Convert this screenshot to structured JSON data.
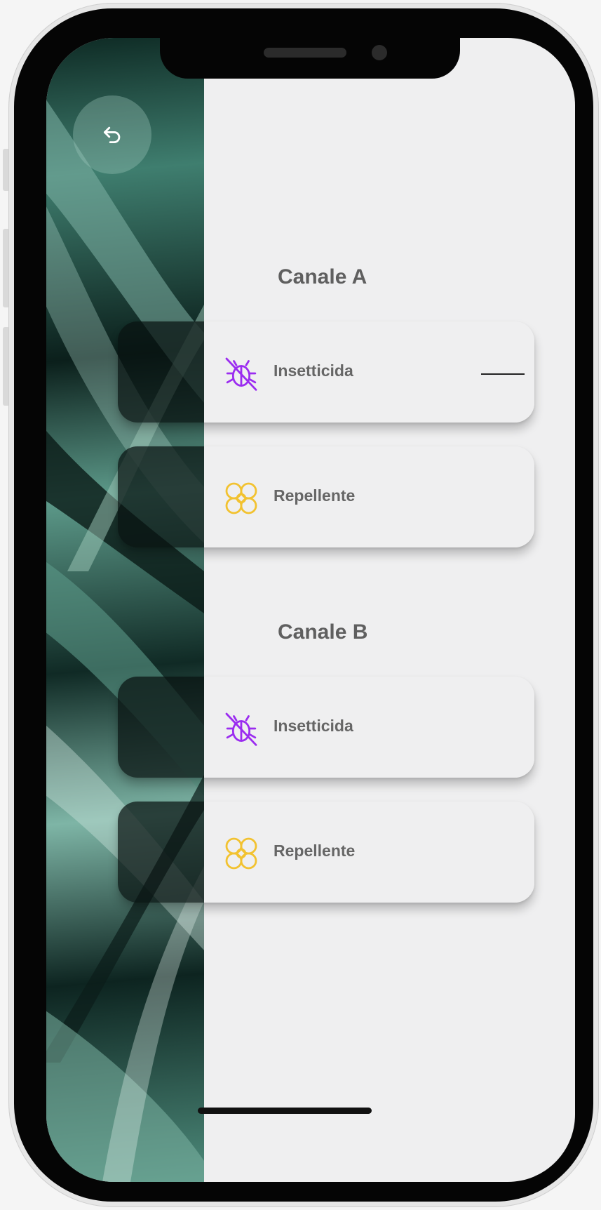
{
  "nav": {
    "back_icon": "undo-arrow-icon"
  },
  "sections": [
    {
      "title": "Canale A",
      "items": [
        {
          "label": "Insetticida",
          "icon": "no-bug-icon",
          "icon_color": "#9b2cf0"
        },
        {
          "label": "Repellente",
          "icon": "flower-icon",
          "icon_color": "#f2c230"
        }
      ]
    },
    {
      "title": "Canale B",
      "items": [
        {
          "label": "Insetticida",
          "icon": "no-bug-icon",
          "icon_color": "#9b2cf0"
        },
        {
          "label": "Repellente",
          "icon": "flower-icon",
          "icon_color": "#f2c230"
        }
      ]
    }
  ],
  "colors": {
    "background": "#efeff0",
    "title_text": "#5f5f5f",
    "label_text": "#666666",
    "insecticide_accent": "#9b2cf0",
    "repellent_accent": "#f2c230"
  }
}
